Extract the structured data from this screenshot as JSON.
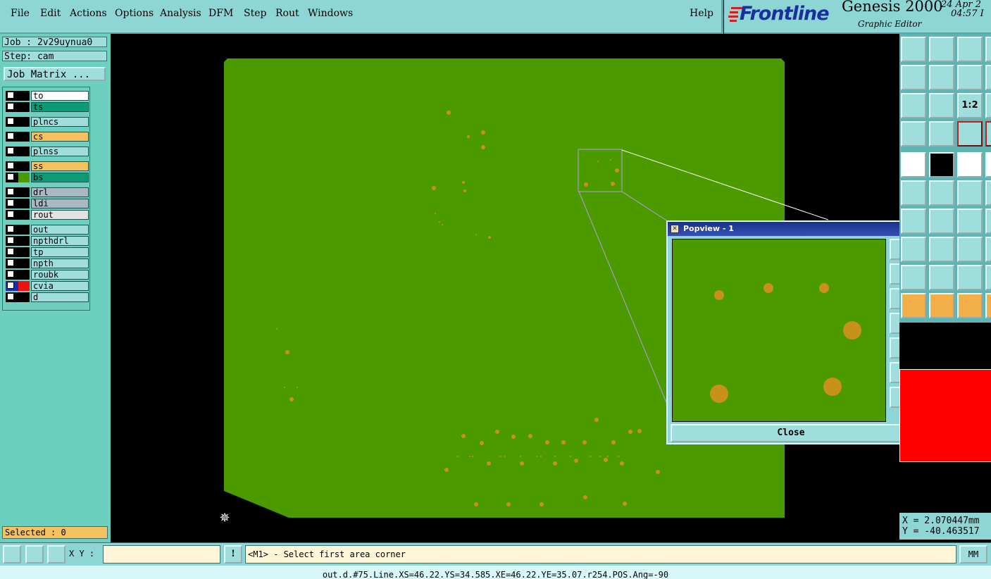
{
  "menu": {
    "items": [
      "File",
      "Edit",
      "Actions",
      "Options",
      "Analysis",
      "DFM",
      "Step",
      "Rout",
      "Windows"
    ],
    "help": "Help"
  },
  "brand": {
    "logo": "Frontline",
    "product": "Genesis 2000",
    "subtitle": "Graphic Editor",
    "date": "24 Apr 2",
    "time": "04:57 I"
  },
  "job": {
    "job_label": "Job : 2v29uynua0",
    "step_label": "Step: cam",
    "matrix_button": "Job Matrix ..."
  },
  "layers": [
    {
      "name": "to",
      "bg": "#ffffff",
      "color": "#000000"
    },
    {
      "name": "ts",
      "bg": "#0d9a75",
      "color": "#000000"
    },
    {
      "name": "plncs",
      "bg": "#9fdedd",
      "color": "#000000"
    },
    {
      "name": "cs",
      "bg": "#f5c262",
      "color": "#000000"
    },
    {
      "name": "plnss",
      "bg": "#9fdedd",
      "color": "#000000"
    },
    {
      "name": "ss",
      "bg": "#f5c262",
      "color": "#000000"
    },
    {
      "name": "bs",
      "bg": "#0d9a75",
      "color": "#4a9a00"
    },
    {
      "name": "drl",
      "bg": "#a9b8c2",
      "color": "#000000"
    },
    {
      "name": "ldi",
      "bg": "#a9b8c2",
      "color": "#000000"
    },
    {
      "name": "rout",
      "bg": "#e2e2e2",
      "color": "#000000"
    },
    {
      "name": "out",
      "bg": "#9fdedd",
      "color": "#000000"
    },
    {
      "name": "npthdrl",
      "bg": "#9fdedd",
      "color": "#000000"
    },
    {
      "name": "tp",
      "bg": "#9fdedd",
      "color": "#000000"
    },
    {
      "name": "npth",
      "bg": "#9fdedd",
      "color": "#000000"
    },
    {
      "name": "roubk",
      "bg": "#9fdedd",
      "color": "#000000"
    },
    {
      "name": "cvia",
      "bg": "#9fdedd",
      "color": "#ee1111"
    },
    {
      "name": "d",
      "bg": "#9fdedd",
      "color": "#000000"
    }
  ],
  "selected": "Selected : 0",
  "popview": {
    "title": "Popview - 1",
    "close_button": "Close"
  },
  "coords": {
    "x": "X = 2.070447mm",
    "y": "Y = -40.463517"
  },
  "bottom": {
    "xy_label": "X Y :",
    "xy_value": "",
    "prompt": "<M1> - Select first area corner",
    "units": "MM",
    "status": "out.d.#75.Line.XS=46.22.YS=34.585.XE=46.22.YE=35.07.r254.POS.Ang=-90"
  },
  "colors": {
    "board": "#4a9a00",
    "pad": "#c8921a",
    "panel": "#8ed6d6"
  }
}
